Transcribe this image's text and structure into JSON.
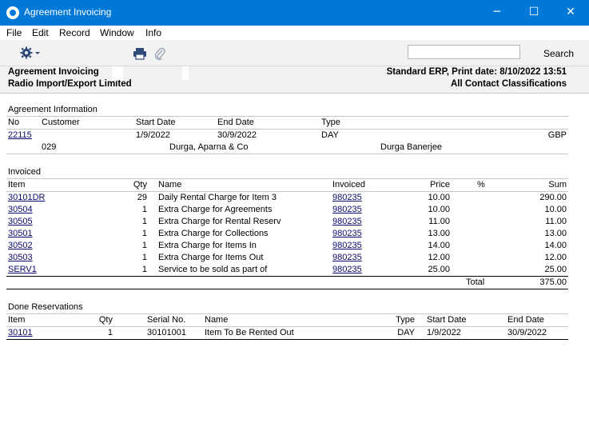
{
  "window": {
    "title": "Agreement Invoicing",
    "controls": {
      "minimize": "─",
      "maximize": "☐",
      "close": "✕"
    }
  },
  "menu": [
    "File",
    "Edit",
    "Record",
    "Window",
    "Info"
  ],
  "toolbar": {
    "icons": [
      "gear-icon",
      "printer-icon",
      "paperclip-icon"
    ],
    "search_value": "",
    "search_label": "Search"
  },
  "report_header": {
    "report_name": "Agreement Invoicing",
    "company": "Radio Import/Export Limited",
    "system_info": "Standard ERP, Print date: 8/10/2022 13:51",
    "classification": "All Contact Classifications"
  },
  "agreement_info": {
    "section_title": "Agreement Information",
    "headers": {
      "no": "No",
      "customer": "Customer",
      "start_date": "Start Date",
      "end_date": "End Date",
      "type": "Type"
    },
    "no": "22115",
    "start_date": "1/9/2022",
    "end_date": "30/9/2022",
    "type": "DAY",
    "currency": "GBP",
    "customer_code": "029",
    "customer_name": "Durga, Aparna & Co",
    "contact": "Durga Banerjee"
  },
  "invoiced": {
    "section_title": "Invoiced",
    "headers": {
      "item": "Item",
      "qty": "Qty",
      "name": "Name",
      "invoiced": "Invoiced",
      "price": "Price",
      "percent": "%",
      "sum": "Sum"
    },
    "rows": [
      {
        "item": "30101DR",
        "qty": "29",
        "name": "Daily Rental Charge for Item 3",
        "invoiced": "980235",
        "price": "10.00",
        "sum": "290.00"
      },
      {
        "item": "30504",
        "qty": "1",
        "name": "Extra Charge for Agreements",
        "invoiced": "980235",
        "price": "10.00",
        "sum": "10.00"
      },
      {
        "item": "30505",
        "qty": "1",
        "name": "Extra Charge for Rental Reserv",
        "invoiced": "980235",
        "price": "11.00",
        "sum": "11.00"
      },
      {
        "item": "30501",
        "qty": "1",
        "name": "Extra Charge for Collections",
        "invoiced": "980235",
        "price": "13.00",
        "sum": "13.00"
      },
      {
        "item": "30502",
        "qty": "1",
        "name": "Extra Charge for Items In",
        "invoiced": "980235",
        "price": "14.00",
        "sum": "14.00"
      },
      {
        "item": "30503",
        "qty": "1",
        "name": "Extra Charge for Items Out",
        "invoiced": "980235",
        "price": "12.00",
        "sum": "12.00"
      },
      {
        "item": "SERV1",
        "qty": "1",
        "name": "Service to be sold as part of",
        "invoiced": "980235",
        "price": "25.00",
        "sum": "25.00"
      }
    ],
    "total_label": "Total",
    "total_value": "375.00"
  },
  "done_reservations": {
    "section_title": "Done Reservations",
    "headers": {
      "item": "Item",
      "qty": "Qty",
      "serial": "Serial No.",
      "name": "Name",
      "type": "Type",
      "start_date": "Start Date",
      "end_date": "End Date"
    },
    "rows": [
      {
        "item": "30101",
        "qty": "1",
        "serial": "30101001",
        "name": "Item To Be Rented Out",
        "type": "DAY",
        "start_date": "1/9/2022",
        "end_date": "30/9/2022"
      }
    ]
  }
}
